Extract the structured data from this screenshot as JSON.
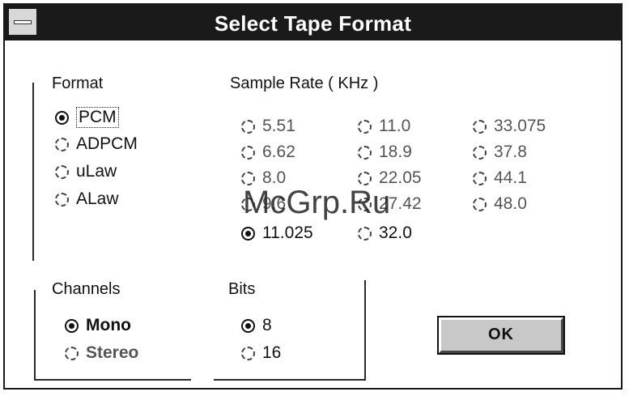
{
  "window": {
    "title": "Select Tape Format"
  },
  "format": {
    "label": "Format",
    "options": [
      {
        "label": "PCM",
        "selected": true
      },
      {
        "label": "ADPCM",
        "selected": false
      },
      {
        "label": "uLaw",
        "selected": false
      },
      {
        "label": "ALaw",
        "selected": false
      }
    ]
  },
  "sample_rate": {
    "label": "Sample Rate ( KHz )",
    "options": [
      {
        "label": "5.51",
        "selected": false
      },
      {
        "label": "6.62",
        "selected": false
      },
      {
        "label": "8.0",
        "selected": false
      },
      {
        "label": "9.6",
        "selected": false
      },
      {
        "label": "11.025",
        "selected": true
      },
      {
        "label": "11.0",
        "selected": false
      },
      {
        "label": "18.9",
        "selected": false
      },
      {
        "label": "22.05",
        "selected": false
      },
      {
        "label": "27.42",
        "selected": false
      },
      {
        "label": "32.0",
        "selected": false
      },
      {
        "label": "33.075",
        "selected": false
      },
      {
        "label": "37.8",
        "selected": false
      },
      {
        "label": "44.1",
        "selected": false
      },
      {
        "label": "48.0",
        "selected": false
      }
    ]
  },
  "channels": {
    "label": "Channels",
    "options": [
      {
        "label": "Mono",
        "selected": true
      },
      {
        "label": "Stereo",
        "selected": false
      }
    ]
  },
  "bits": {
    "label": "Bits",
    "options": [
      {
        "label": "8",
        "selected": true
      },
      {
        "label": "16",
        "selected": false
      }
    ]
  },
  "ok_button": {
    "label": "OK"
  },
  "watermark": "McGrp.Ru"
}
